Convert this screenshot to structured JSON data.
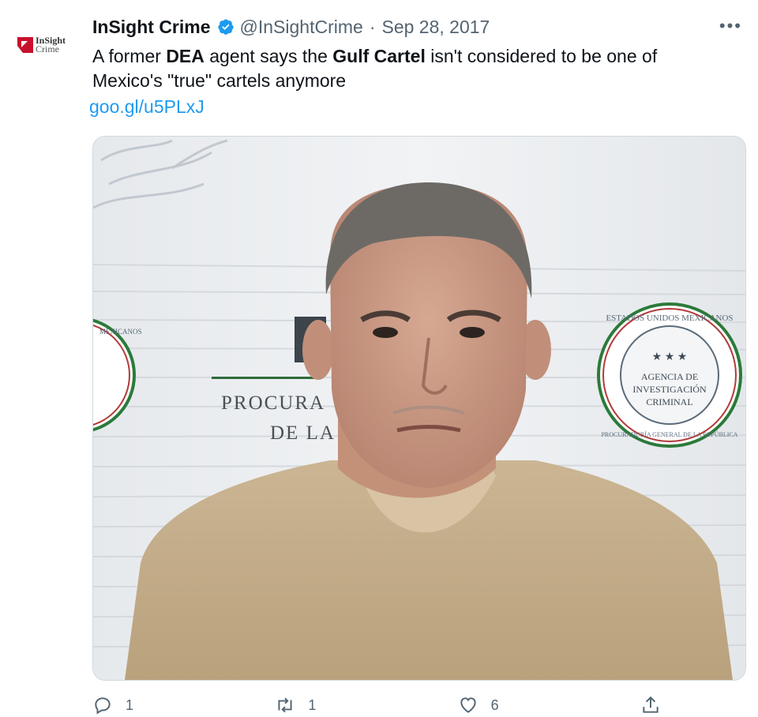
{
  "tweet": {
    "author_name": "InSight Crime",
    "handle": "@InSightCrime",
    "separator": "·",
    "date": "Sep 28, 2017",
    "more": "•••",
    "text_parts": [
      {
        "text": "A former ",
        "bold": false
      },
      {
        "text": "DEA",
        "bold": true
      },
      {
        "text": " agent says the ",
        "bold": false
      },
      {
        "text": "Gulf Cartel",
        "bold": true
      },
      {
        "text": " isn't considered to be one of Mexico's \"true\" cartels anymore",
        "bold": false
      }
    ],
    "link_text": "goo.gl/u5PLxJ",
    "avatar": {
      "line1": "InSight",
      "line2": "Crime"
    }
  },
  "media": {
    "backdrop_text_1": "PROCURA",
    "backdrop_text_2": "DE LA",
    "seal_ring_top": "ESTADOS UNIDOS MEXICANOS",
    "seal_ring_bottom": "PROCURADURÍA GENERAL DE LA REPÚBLICA",
    "seal_line1": "AGENCIA DE",
    "seal_line2": "INVESTIGACIÓN",
    "seal_line3": "CRIMINAL",
    "seal_stars": "★ ★ ★",
    "left_seal_ring": "MEXICANOS"
  },
  "actions": {
    "reply_count": "1",
    "retweet_count": "1",
    "like_count": "6"
  },
  "colors": {
    "accent": "#1d9bf0",
    "secondary_text": "#536471",
    "brand_red": "#c8102e"
  }
}
